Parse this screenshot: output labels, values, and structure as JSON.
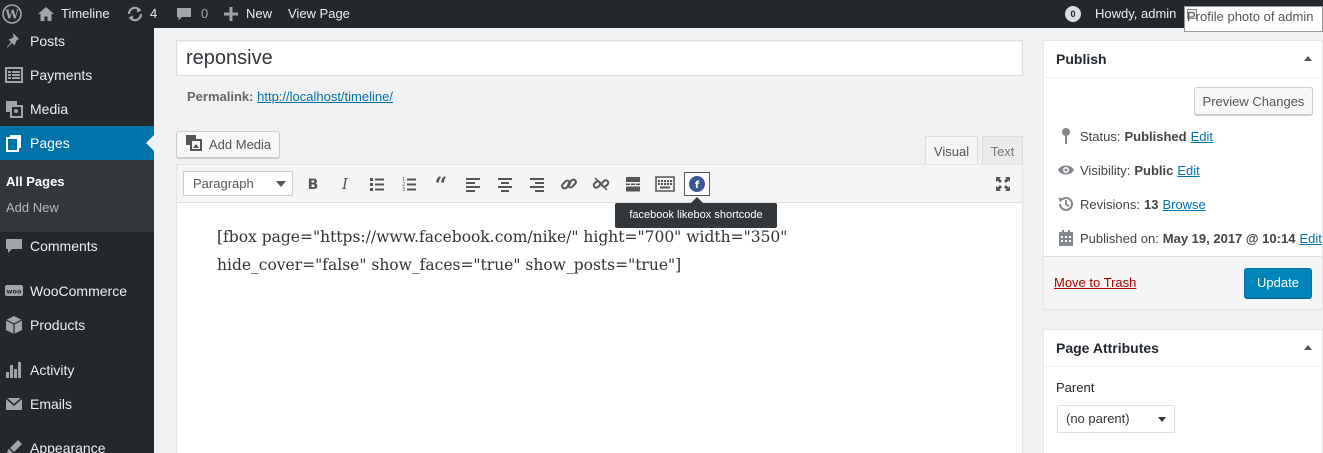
{
  "adminbar": {
    "site_name": "Timeline",
    "updates_count": "4",
    "comments_count": "0",
    "new_label": "New",
    "view_page_label": "View Page",
    "notification_count": "0",
    "howdy": "Howdy, admin",
    "avatar_alt": "Profile photo of admin"
  },
  "sidebar": {
    "items": [
      {
        "label": "Posts",
        "icon": "pushpin-icon"
      },
      {
        "label": "Payments",
        "icon": "list-icon"
      },
      {
        "label": "Media",
        "icon": "media-icon"
      },
      {
        "label": "Pages",
        "icon": "pages-icon"
      },
      {
        "label": "Comments",
        "icon": "comment-icon"
      },
      {
        "label": "WooCommerce",
        "icon": "woocommerce-icon"
      },
      {
        "label": "Products",
        "icon": "box-icon"
      },
      {
        "label": "Activity",
        "icon": "activity-icon"
      },
      {
        "label": "Emails",
        "icon": "mail-icon"
      },
      {
        "label": "Appearance",
        "icon": "brush-icon"
      }
    ],
    "submenu": [
      {
        "label": "All Pages"
      },
      {
        "label": "Add New"
      }
    ]
  },
  "editor": {
    "title": "reponsive",
    "permalink_label": "Permalink:",
    "permalink_url": "http://localhost/timeline/",
    "add_media_label": "Add Media",
    "tab_visual": "Visual",
    "tab_text": "Text",
    "format_select": "Paragraph",
    "tooltip": "facebook likebox shortcode",
    "content_line1": "[fbox page=\"https://www.facebook.com/nike/\" hight=\"700\" width=\"350\"",
    "content_line2": "hide_cover=\"false\" show_faces=\"true\" show_posts=\"true\"]"
  },
  "publish": {
    "title": "Publish",
    "preview_label": "Preview Changes",
    "status_label": "Status:",
    "status_value": "Published",
    "visibility_label": "Visibility:",
    "visibility_value": "Public",
    "revisions_label": "Revisions:",
    "revisions_value": "13",
    "browse_label": "Browse",
    "published_label": "Published on:",
    "published_value": "May 19, 2017 @ 10:14",
    "edit_label": "Edit",
    "trash_label": "Move to Trash",
    "update_label": "Update"
  },
  "page_attributes": {
    "title": "Page Attributes",
    "parent_label": "Parent",
    "parent_value": "(no parent)"
  },
  "colors": {
    "admin_dark": "#23282d",
    "accent_blue": "#0073aa",
    "update_button": "#0085ba",
    "trash_red": "#a00000"
  }
}
